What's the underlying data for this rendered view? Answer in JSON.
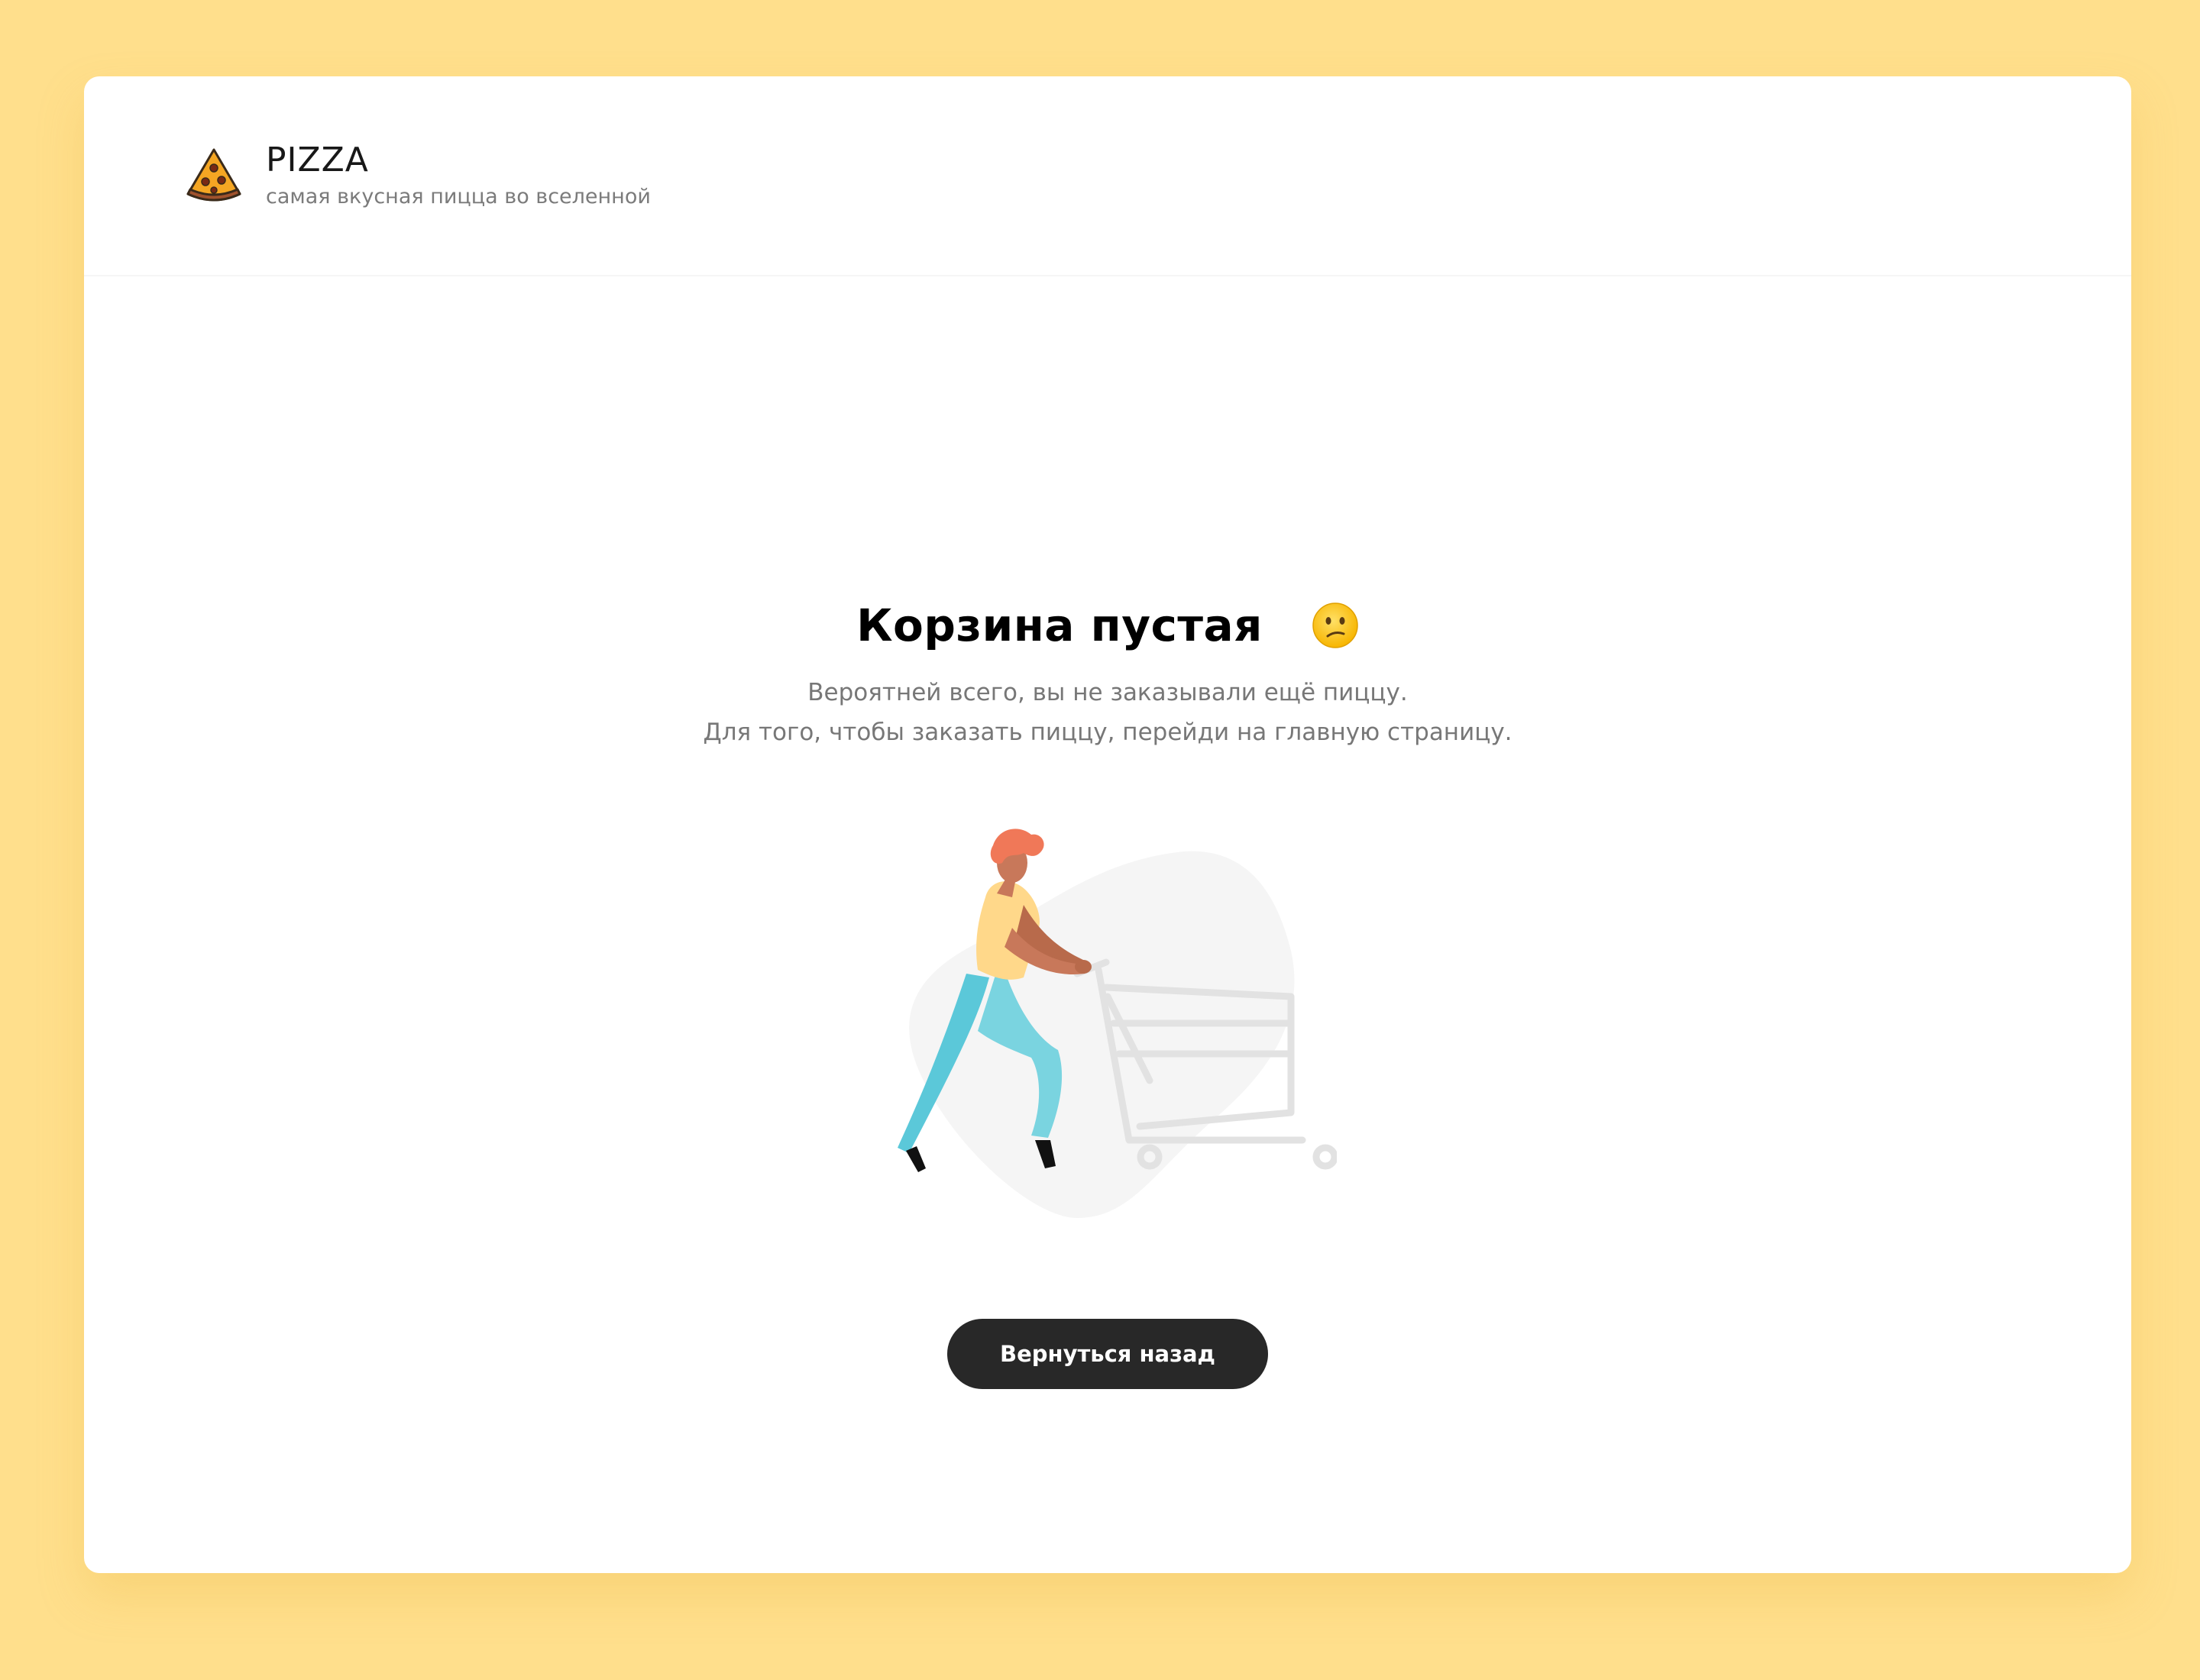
{
  "header": {
    "title": "PIZZA",
    "subtitle": "самая вкусная пицца во вселенной",
    "logo_icon": "pizza-slice-icon"
  },
  "cart": {
    "title": "Корзина пустая",
    "title_emoji": "confused-face-icon",
    "description_line1": "Вероятней всего, вы не заказывали ещё пиццу.",
    "description_line2": "Для того, чтобы заказать пиццу, перейди на главную страницу.",
    "illustration": "person-with-shopping-cart-illustration",
    "back_button_label": "Вернуться назад"
  },
  "colors": {
    "background": "#FFDF8C",
    "card": "#FFFFFF",
    "button": "#282828",
    "button_text": "#FFFFFF",
    "text_muted": "#777777"
  }
}
